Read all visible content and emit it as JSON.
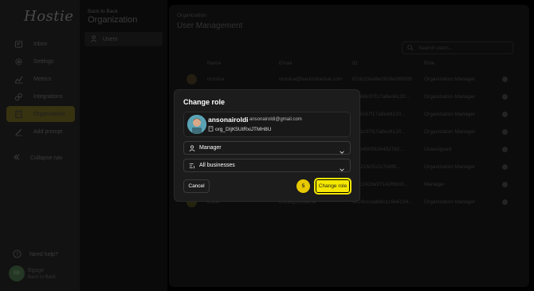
{
  "sidebar": {
    "logo": "Hostie",
    "items": [
      {
        "label": "Inbox",
        "icon": "inbox-icon"
      },
      {
        "label": "Settings",
        "icon": "gear-icon"
      },
      {
        "label": "Metrics",
        "icon": "chart-icon"
      },
      {
        "label": "Integrations",
        "icon": "plug-icon"
      },
      {
        "label": "Organization",
        "icon": "building-icon",
        "active": true
      },
      {
        "label": "Add prompt",
        "icon": "pencil-icon"
      }
    ],
    "collapse_label": "Collapse nav",
    "help_label": "Need help?",
    "user": {
      "initials": "BB",
      "name": "Bgage",
      "org": "Back to Back"
    }
  },
  "org_nav": {
    "back_label": "Back to Back",
    "title": "Organization",
    "users_label": "Users"
  },
  "main": {
    "sup_label": "Organization",
    "title": "User Management",
    "search_placeholder": "Search users...",
    "columns": {
      "name": "Name",
      "email": "Email",
      "id": "ID",
      "role": "Role"
    },
    "rows": [
      {
        "name": "monica",
        "email": "monica@backtobackai.com",
        "id": "67dc33ea9e2616e389595",
        "role": "Organization Manager"
      },
      {
        "name": "",
        "email": "",
        "id": "1eb56c97f17a8ed4120...",
        "role": "Organization Manager"
      },
      {
        "name": "",
        "email": "",
        "id": "1ef6c97f17a8ed4120...",
        "role": "Organization Manager"
      },
      {
        "name": "",
        "email": "",
        "id": "1111c97f17a8ed4120...",
        "role": "Organization Manager"
      },
      {
        "name": "",
        "email": "",
        "id": "6f6b4905636452782...",
        "role": "Unassigned"
      },
      {
        "name": "",
        "email": "",
        "id": "6ffc216c512c7d4f8...",
        "role": "Organization Manager"
      },
      {
        "name": "",
        "email": "",
        "id": "6f1c242de97142f6b03...",
        "role": "Manager"
      },
      {
        "name": "chloe",
        "email": "chloe@hostie.ai",
        "id": "6ff24cccaab8c1c9e6234...",
        "role": "Organization Manager"
      }
    ]
  },
  "modal": {
    "title": "Change role",
    "user": {
      "name": "ansonairoldi",
      "email": "ansonairoldi@gmail.com",
      "id": "org_DIjK5UtRxiJTMH8U"
    },
    "role_select": {
      "value": "Manager",
      "icon": "user-icon"
    },
    "business_select": {
      "value": "All businesses",
      "icon": "list-icon"
    },
    "cancel_label": "Cancel",
    "step_badge": "5",
    "confirm_label": "Change role",
    "colors": {
      "accent": "#f5e800",
      "badge": "#e8c900"
    }
  }
}
